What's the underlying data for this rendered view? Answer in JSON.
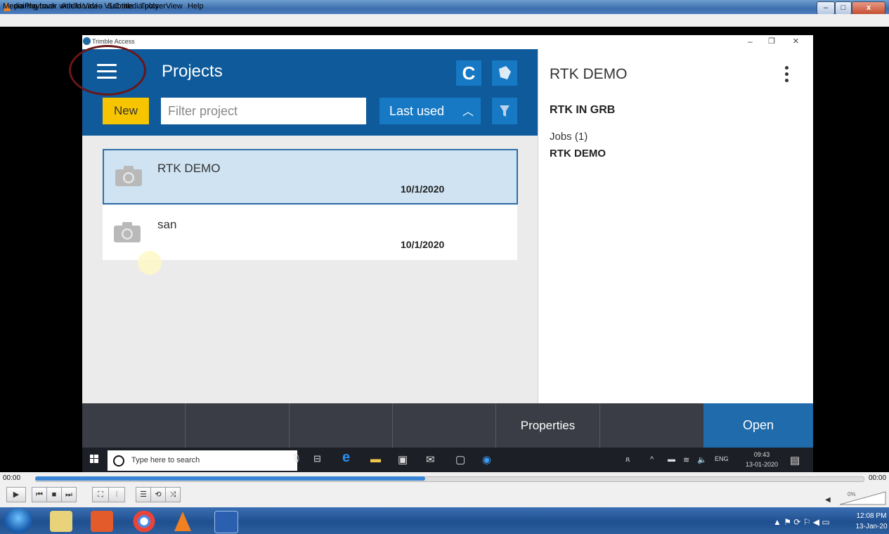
{
  "vlc": {
    "window_title": "pairing rover with fdc.avi - VLC media player",
    "menu": [
      "Media",
      "Playback",
      "Audio",
      "Video",
      "Subtitle",
      "Tools",
      "View",
      "Help"
    ],
    "time_elapsed": "00:00",
    "time_total": "00:00",
    "seek_progress": 0.47,
    "volume_label": "0%"
  },
  "trimble": {
    "window_title": "Trimble Access",
    "header_title": "Projects",
    "new_label": "New",
    "filter_placeholder": "Filter project",
    "sort_label": "Last used",
    "projects": [
      {
        "name": "RTK DEMO",
        "date": "10/1/2020",
        "selected": true
      },
      {
        "name": "san",
        "date": "10/1/2020",
        "selected": false
      }
    ],
    "detail": {
      "title": "RTK DEMO",
      "subtitle": "RTK IN GRB",
      "jobs_label": "Jobs (1)",
      "job_name": "RTK DEMO"
    },
    "bottom_bar": {
      "properties_label": "Properties",
      "open_label": "Open"
    }
  },
  "inner_taskbar": {
    "search_placeholder": "Type here to search",
    "language": "ENG",
    "time": "09:43",
    "date": "13-01-2020"
  },
  "outer_taskbar": {
    "time": "12:08 PM",
    "date": "13-Jan-20"
  }
}
